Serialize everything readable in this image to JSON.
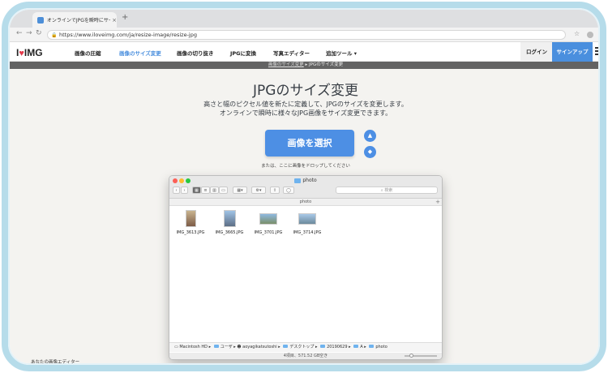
{
  "browser": {
    "tab_title": "オンラインでJPGを瞬時にサイズ",
    "tab_close": "×",
    "new_tab": "+",
    "url": "https://www.iloveimg.com/ja/resize-image/resize-jpg"
  },
  "site": {
    "logo_left": "I",
    "logo_right": "IMG",
    "nav": [
      "画像の圧縮",
      "画像のサイズ変更",
      "画像の切り抜き",
      "JPGに変換",
      "写真エディター",
      "追加ツール ▾"
    ],
    "login": "ログイン",
    "signup": "サインアップ",
    "accent": "#4a8fde",
    "logo_heart_color": "#e33a4b"
  },
  "breadcrumb": {
    "parent": "画像のサイズ変更",
    "separator": "▸",
    "current": "JPGのサイズ変更"
  },
  "main": {
    "title": "JPGのサイズ変更",
    "subtitle_line1": "高さと幅のピクセル値を新たに定義して、JPGのサイズを変更します。",
    "subtitle_line2": "オンラインで瞬時に様々なJPG画像をサイズ変更できます。",
    "select_button": "画像を選択",
    "drop_hint": "または、ここに画像をドロップしてください",
    "bottom_text": "あなたの画像エディター"
  },
  "finder": {
    "window_title": "photo",
    "path_bar": "photo",
    "search_placeholder": "検索",
    "files": [
      {
        "name": "IMG_3613.JPG"
      },
      {
        "name": "IMG_3665.JPG"
      },
      {
        "name": "IMG_3701.JPG"
      },
      {
        "name": "IMG_3714.JPG"
      }
    ],
    "status_path": [
      "Macintosh HD",
      "ユーザ",
      "aoyagikatsutoshi",
      "デスクトップ",
      "20190629",
      "A",
      "photo"
    ],
    "item_count": "4項目、571.52 GB空き"
  }
}
